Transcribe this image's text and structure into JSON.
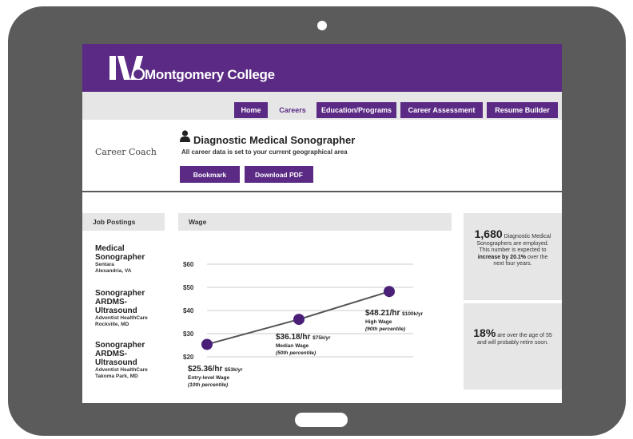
{
  "header": {
    "college_name": "Montgomery College"
  },
  "nav": {
    "items": [
      {
        "label": "Home"
      },
      {
        "label": "Careers"
      },
      {
        "label": "Education/Programs"
      },
      {
        "label": "Career Assessment"
      },
      {
        "label": "Resume Builder"
      }
    ],
    "active": "Careers"
  },
  "career": {
    "brand": "Career Coach",
    "title": "Diagnostic Medical Sonographer",
    "subtitle": "All career data is set to your current geographical area",
    "bookmark_label": "Bookmark",
    "download_label": "Download PDF"
  },
  "job_postings": {
    "heading": "Job Postings",
    "items": [
      {
        "title_lines": [
          "Medical",
          "Sonographer"
        ],
        "company": "Sentara",
        "location": "Alexandria, VA"
      },
      {
        "title_lines": [
          "Sonographer",
          "ARDMS-",
          "Ultrasound"
        ],
        "company": "Adventist HealthCare",
        "location": "Rockville, MD"
      },
      {
        "title_lines": [
          "Sonographer",
          "ARDMS-",
          "Ultrasound"
        ],
        "company": "Adventist HealthCare",
        "location": "Takoma Park, MD"
      }
    ]
  },
  "wage": {
    "heading": "Wage"
  },
  "chart_data": {
    "type": "line",
    "title": "Wage",
    "ylim": [
      20,
      60
    ],
    "yticks": [
      "$60",
      "$50",
      "$40",
      "$30",
      "$20"
    ],
    "ytick_values": [
      60,
      50,
      40,
      30,
      20
    ],
    "grid": true,
    "points": [
      {
        "value": 25.36,
        "label": "$25.36/hr",
        "annual": "$53k/yr",
        "name": "Entry-level Wage",
        "percentile": "(10th percentile)"
      },
      {
        "value": 36.18,
        "label": "$36.18/hr",
        "annual": "$75k/yr",
        "name": "Median Wage",
        "percentile": "(50th percentile)"
      },
      {
        "value": 48.21,
        "label": "$48.21/hr",
        "annual": "$100k/yr",
        "name": "High Wage",
        "percentile": "(90th percentile)"
      }
    ],
    "colors": {
      "line": "#555555",
      "marker": "#4a1f78",
      "grid": "#bdbdbd"
    }
  },
  "stats": {
    "employed": {
      "number": "1,680",
      "text1": "Diagnostic Medical Sonographers are employed. This number is expected to",
      "bold1": "increase by 20.1%",
      "text2": "over the next four years."
    },
    "retire": {
      "number": "18%",
      "text": "are over the age of 55 and will probably retire soon."
    }
  },
  "colors": {
    "brand_purple": "#5a2a84",
    "panel_gray": "#e6e6e7",
    "device": "#5b5b5b"
  }
}
